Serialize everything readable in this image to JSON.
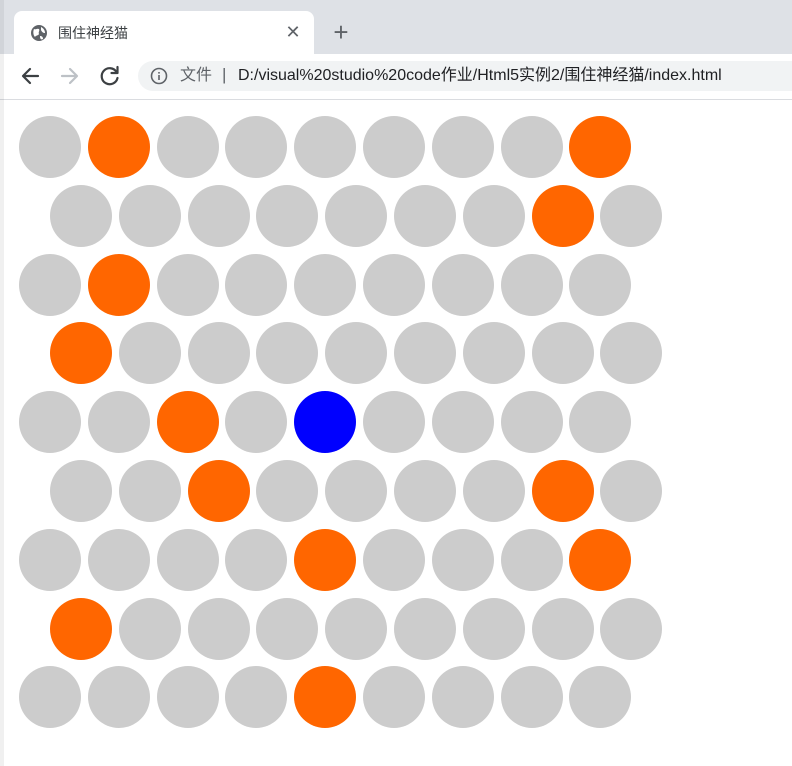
{
  "tab": {
    "title": "围住神经猫",
    "favicon": "globe-icon",
    "close_icon": "close-icon"
  },
  "new_tab_icon": "plus-icon",
  "toolbar": {
    "back_icon": "back-arrow-icon",
    "forward_icon": "forward-arrow-icon",
    "reload_icon": "reload-icon",
    "info_icon": "info-icon",
    "url_prefix": "文件",
    "url_separator": "|",
    "url": "D:/visual%20studio%20code作业/Html5实例2/围住神经猫/index.html"
  },
  "colors": {
    "empty": "#cccccc",
    "wall": "#ff6600",
    "cat": "#0000ff",
    "chrome_bg": "#dee1e6"
  },
  "board": {
    "rows": 9,
    "cols": 9,
    "cells": [
      [
        "empty",
        "wall",
        "empty",
        "empty",
        "empty",
        "empty",
        "empty",
        "empty",
        "wall"
      ],
      [
        "empty",
        "empty",
        "empty",
        "empty",
        "empty",
        "empty",
        "empty",
        "wall",
        "empty"
      ],
      [
        "empty",
        "wall",
        "empty",
        "empty",
        "empty",
        "empty",
        "empty",
        "empty",
        "empty"
      ],
      [
        "wall",
        "empty",
        "empty",
        "empty",
        "empty",
        "empty",
        "empty",
        "empty",
        "empty"
      ],
      [
        "empty",
        "empty",
        "wall",
        "empty",
        "cat",
        "empty",
        "empty",
        "empty",
        "empty"
      ],
      [
        "empty",
        "empty",
        "wall",
        "empty",
        "empty",
        "empty",
        "empty",
        "wall",
        "empty"
      ],
      [
        "empty",
        "empty",
        "empty",
        "empty",
        "wall",
        "empty",
        "empty",
        "empty",
        "wall"
      ],
      [
        "wall",
        "empty",
        "empty",
        "empty",
        "empty",
        "empty",
        "empty",
        "empty",
        "empty"
      ],
      [
        "empty",
        "empty",
        "empty",
        "empty",
        "wall",
        "empty",
        "empty",
        "empty",
        "empty"
      ]
    ]
  }
}
